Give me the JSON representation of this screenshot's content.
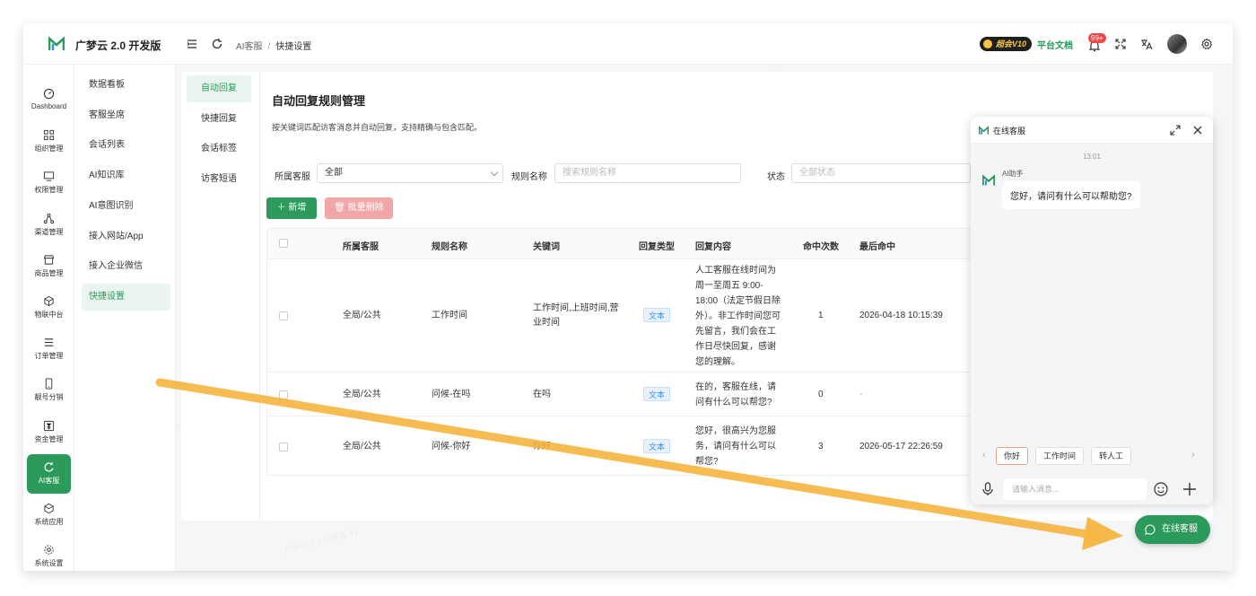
{
  "app": {
    "brand": "广梦云 2.0 开发版"
  },
  "breadcrumb": [
    "AI客服",
    "快捷设置"
  ],
  "header": {
    "vip": "超会V10",
    "docs": "平台文档",
    "badge": "99+"
  },
  "rail": [
    {
      "label": "Dashboard",
      "icon": "dashboard-icon"
    },
    {
      "label": "组织管理",
      "icon": "grid-icon"
    },
    {
      "label": "权限管理",
      "icon": "monitor-icon"
    },
    {
      "label": "渠道管理",
      "icon": "network-icon"
    },
    {
      "label": "商品管理",
      "icon": "store-icon"
    },
    {
      "label": "物联中台",
      "icon": "cube-icon"
    },
    {
      "label": "订单管理",
      "icon": "list-icon"
    },
    {
      "label": "靓号分销",
      "icon": "phone-icon"
    },
    {
      "label": "资金管理",
      "icon": "yen-icon"
    },
    {
      "label": "AI客服",
      "icon": "ai-icon",
      "active": true
    },
    {
      "label": "系统应用",
      "icon": "package-icon"
    },
    {
      "label": "系统设置",
      "icon": "gear-icon"
    }
  ],
  "submenu": [
    "数据看板",
    "客服坐席",
    "会话列表",
    "AI知识库",
    "AI意图识别",
    "接入网站/App",
    "接入企业微信",
    "快捷设置"
  ],
  "tabs": [
    "自动回复",
    "快捷回复",
    "会话标签",
    "访客短语"
  ],
  "panel": {
    "title": "自动回复规则管理",
    "desc": "按关键词匹配访客消息并自动回复，支持精确与包含匹配。"
  },
  "filters": {
    "agent_label": "所属客服",
    "agent_value": "全部",
    "rule_label": "规则名称",
    "rule_placeholder": "搜索规则名称",
    "status_label": "状态",
    "status_placeholder": "全部状态"
  },
  "buttons": {
    "add": "新增",
    "batch_delete": "批量删除"
  },
  "table": {
    "headers": [
      "所属客服",
      "规则名称",
      "关键词",
      "回复类型",
      "回复内容",
      "命中次数",
      "最后命中"
    ],
    "rows": [
      {
        "agent": "全局/公共",
        "name": "工作时间",
        "keywords": [
          "工作时间,上班时间,营",
          "业时间"
        ],
        "type": "文本",
        "content": [
          "人工客服在线时间为",
          "周一至周五 9:00-",
          "18:00（法定节假日除",
          "外）。非工作时间您可",
          "先留言，我们会在工",
          "作日尽快回复，感谢",
          "您的理解。"
        ],
        "hits": "1",
        "last": "2026-04-18 10:15:39"
      },
      {
        "agent": "全局/公共",
        "name": "问候-在吗",
        "keywords": [
          "在吗"
        ],
        "type": "文本",
        "content": [
          "在的，客服在线，请",
          "问有什么可以帮您?"
        ],
        "hits": "0",
        "last": "-"
      },
      {
        "agent": "全局/公共",
        "name": "问候-你好",
        "keywords": [
          "你好"
        ],
        "type": "文本",
        "content": [
          "您好，很高兴为您服",
          "务，请问有什么可以",
          "帮您?"
        ],
        "hits": "3",
        "last": "2026-05-17 22:26:59"
      }
    ]
  },
  "chat": {
    "title": "在线客服",
    "time": "13:01",
    "bot_name": "AI助手",
    "bot_message": "您好，请问有什么可以帮助您?",
    "quick_replies": [
      "你好",
      "工作时间",
      "转人工"
    ],
    "input_placeholder": "请输入消息...",
    "float_button": "在线客服"
  },
  "watermark": "广梦云 2.0 开发版 #1",
  "colors": {
    "accent": "#2b9a5a",
    "danger": "#f3a6a6",
    "arrow": "#f5b53f"
  }
}
